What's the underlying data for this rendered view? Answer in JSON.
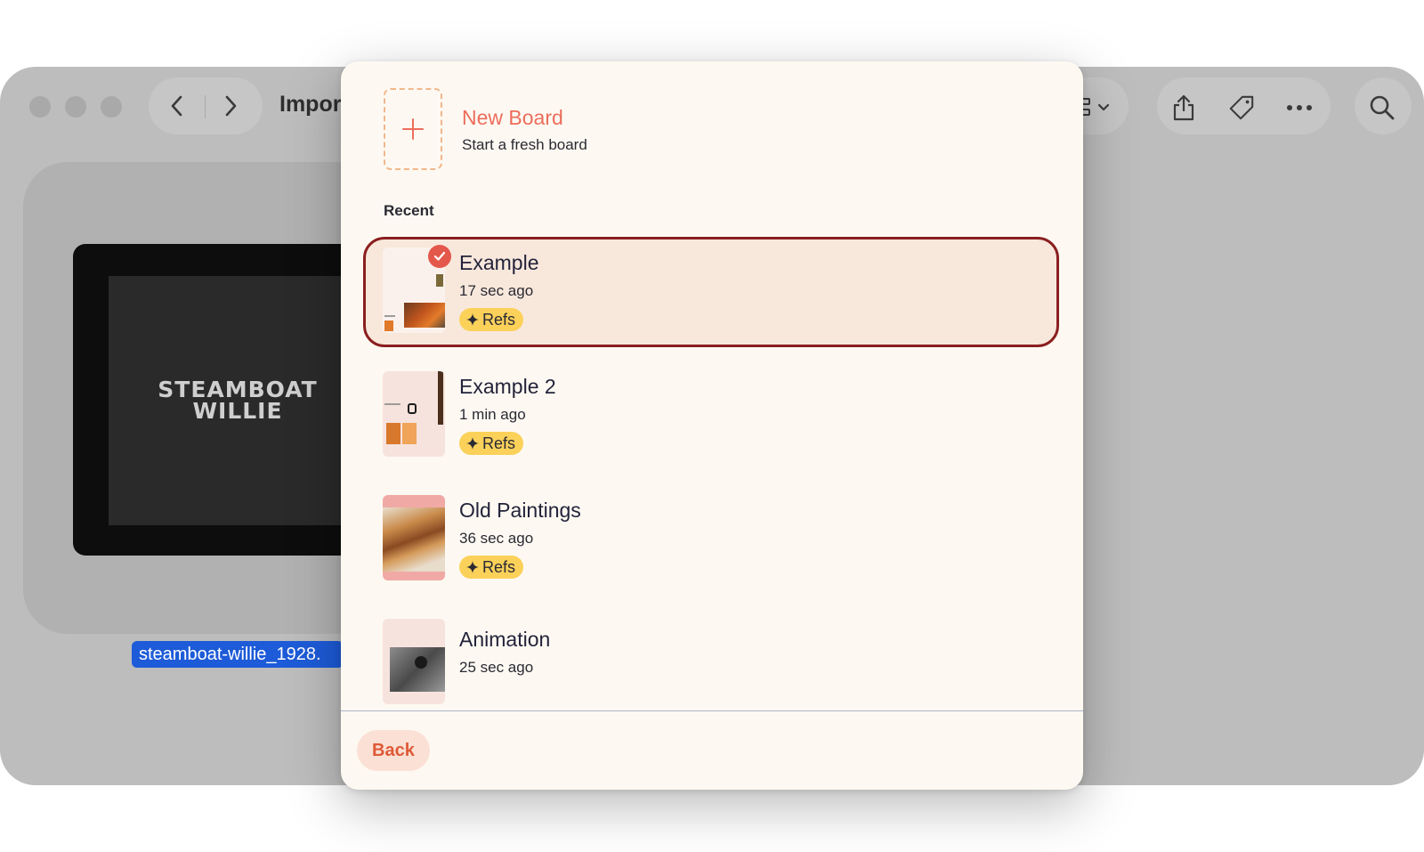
{
  "window": {
    "title": "Impor",
    "filename": "steamboat-willie_1928.",
    "thumbnail_text": [
      "STEAMBOAT",
      "WILLIE"
    ]
  },
  "popover": {
    "new_board": {
      "title": "New Board",
      "subtitle": "Start a fresh board",
      "icon": "plus-icon"
    },
    "recent_label": "Recent",
    "boards": [
      {
        "name": "Example",
        "time": "17 sec ago",
        "badge": "Refs",
        "selected": true
      },
      {
        "name": "Example 2",
        "time": "1 min ago",
        "badge": "Refs",
        "selected": false
      },
      {
        "name": "Old Paintings",
        "time": "36 sec ago",
        "badge": "Refs",
        "selected": false
      },
      {
        "name": "Animation",
        "time": "25 sec ago",
        "badge": null,
        "selected": false
      }
    ],
    "back_label": "Back"
  },
  "colors": {
    "accent": "#ec6d5b",
    "selected_border": "#8a1f1f",
    "badge": "#fbd15a",
    "selection_blue": "#1d5bd8"
  }
}
